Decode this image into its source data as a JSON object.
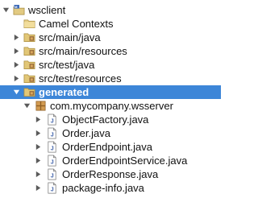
{
  "tree": {
    "project": {
      "label": "wsclient",
      "icon": "maven-project-icon"
    },
    "camel_contexts": {
      "label": "Camel Contexts",
      "icon": "folder-icon"
    },
    "src_main_java": {
      "label": "src/main/java",
      "icon": "source-folder-icon"
    },
    "src_main_resources": {
      "label": "src/main/resources",
      "icon": "source-folder-icon"
    },
    "src_test_java": {
      "label": "src/test/java",
      "icon": "source-folder-icon"
    },
    "src_test_resources": {
      "label": "src/test/resources",
      "icon": "source-folder-icon"
    },
    "generated": {
      "label": "generated",
      "icon": "source-folder-icon",
      "selected": true
    },
    "package": {
      "label": "com.mycompany.wsserver",
      "icon": "package-icon"
    },
    "files": [
      {
        "label": "ObjectFactory.java",
        "icon": "java-file-icon"
      },
      {
        "label": "Order.java",
        "icon": "java-file-icon"
      },
      {
        "label": "OrderEndpoint.java",
        "icon": "java-file-icon"
      },
      {
        "label": "OrderEndpointService.java",
        "icon": "java-file-icon"
      },
      {
        "label": "OrderResponse.java",
        "icon": "java-file-icon"
      },
      {
        "label": "package-info.java",
        "icon": "java-file-icon"
      }
    ],
    "colors": {
      "selection": "#3d86d8",
      "folder": "#d9c27a",
      "package": "#c98a3a"
    }
  }
}
